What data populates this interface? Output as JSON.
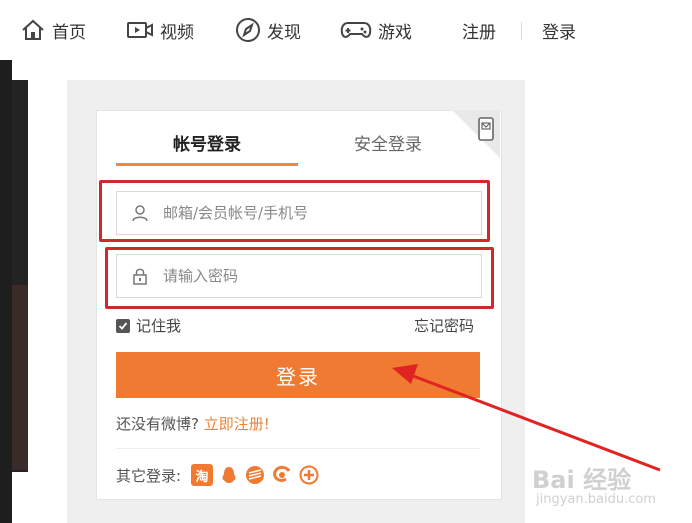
{
  "nav": {
    "items": [
      {
        "label": "首页",
        "icon": "home-icon"
      },
      {
        "label": "视频",
        "icon": "video-icon"
      },
      {
        "label": "发现",
        "icon": "compass-icon"
      },
      {
        "label": "游戏",
        "icon": "gamepad-icon"
      },
      {
        "label": "注册",
        "icon": ""
      },
      {
        "label": "登录",
        "icon": ""
      }
    ]
  },
  "login": {
    "tabs": [
      {
        "label": "帐号登录",
        "active": true
      },
      {
        "label": "安全登录",
        "active": false
      }
    ],
    "username_placeholder": "邮箱/会员帐号/手机号",
    "password_placeholder": "请输入密码",
    "remember_label": "记住我",
    "remember_checked": true,
    "forgot_label": "忘记密码",
    "submit_label": "登录",
    "register_prompt": "还没有微博?",
    "register_link": "立即注册!",
    "other_login_label": "其它登录:",
    "other_logins": [
      "taobao-icon",
      "qq-icon",
      "tianyi-icon",
      "360-icon",
      "other-icon"
    ],
    "other_first_glyph": "淘"
  },
  "colors": {
    "accent": "#f07a32",
    "highlight_frame": "#cf2a2a",
    "arrow": "#e02424"
  },
  "watermark": {
    "text": "Bai 经验",
    "sub": "jingyan.baidu.com"
  }
}
